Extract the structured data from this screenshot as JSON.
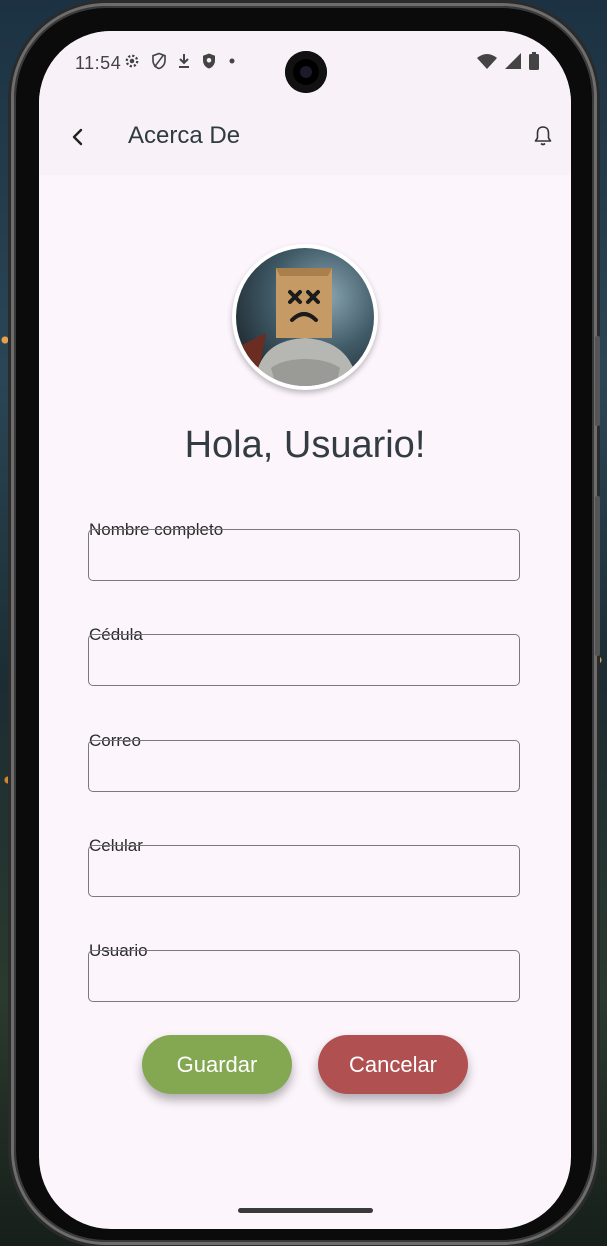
{
  "status_bar": {
    "time": "11:54",
    "icons": [
      "gear-icon",
      "shield-outline-icon",
      "download-icon",
      "shield-icon",
      "dot-icon"
    ],
    "system_icons": [
      "wifi-icon",
      "signal-icon",
      "battery-icon"
    ]
  },
  "app_bar": {
    "title": "Acerca De",
    "back_icon": "chevron-left-icon",
    "notification_icon": "bell-icon"
  },
  "profile": {
    "greeting": "Hola, Usuario!"
  },
  "form": {
    "fields": [
      {
        "label": "Nombre completo",
        "value": "",
        "placeholder": ""
      },
      {
        "label": "Cédula",
        "value": "",
        "placeholder": ""
      },
      {
        "label": "Correo",
        "value": "",
        "placeholder": ""
      },
      {
        "label": "Celular",
        "value": "",
        "placeholder": ""
      },
      {
        "label": "Usuario",
        "value": "",
        "placeholder": ""
      }
    ]
  },
  "actions": {
    "save_label": "Guardar",
    "cancel_label": "Cancelar"
  },
  "colors": {
    "save": "#84a852",
    "cancel": "#b05050",
    "background": "#fcf5fc"
  }
}
